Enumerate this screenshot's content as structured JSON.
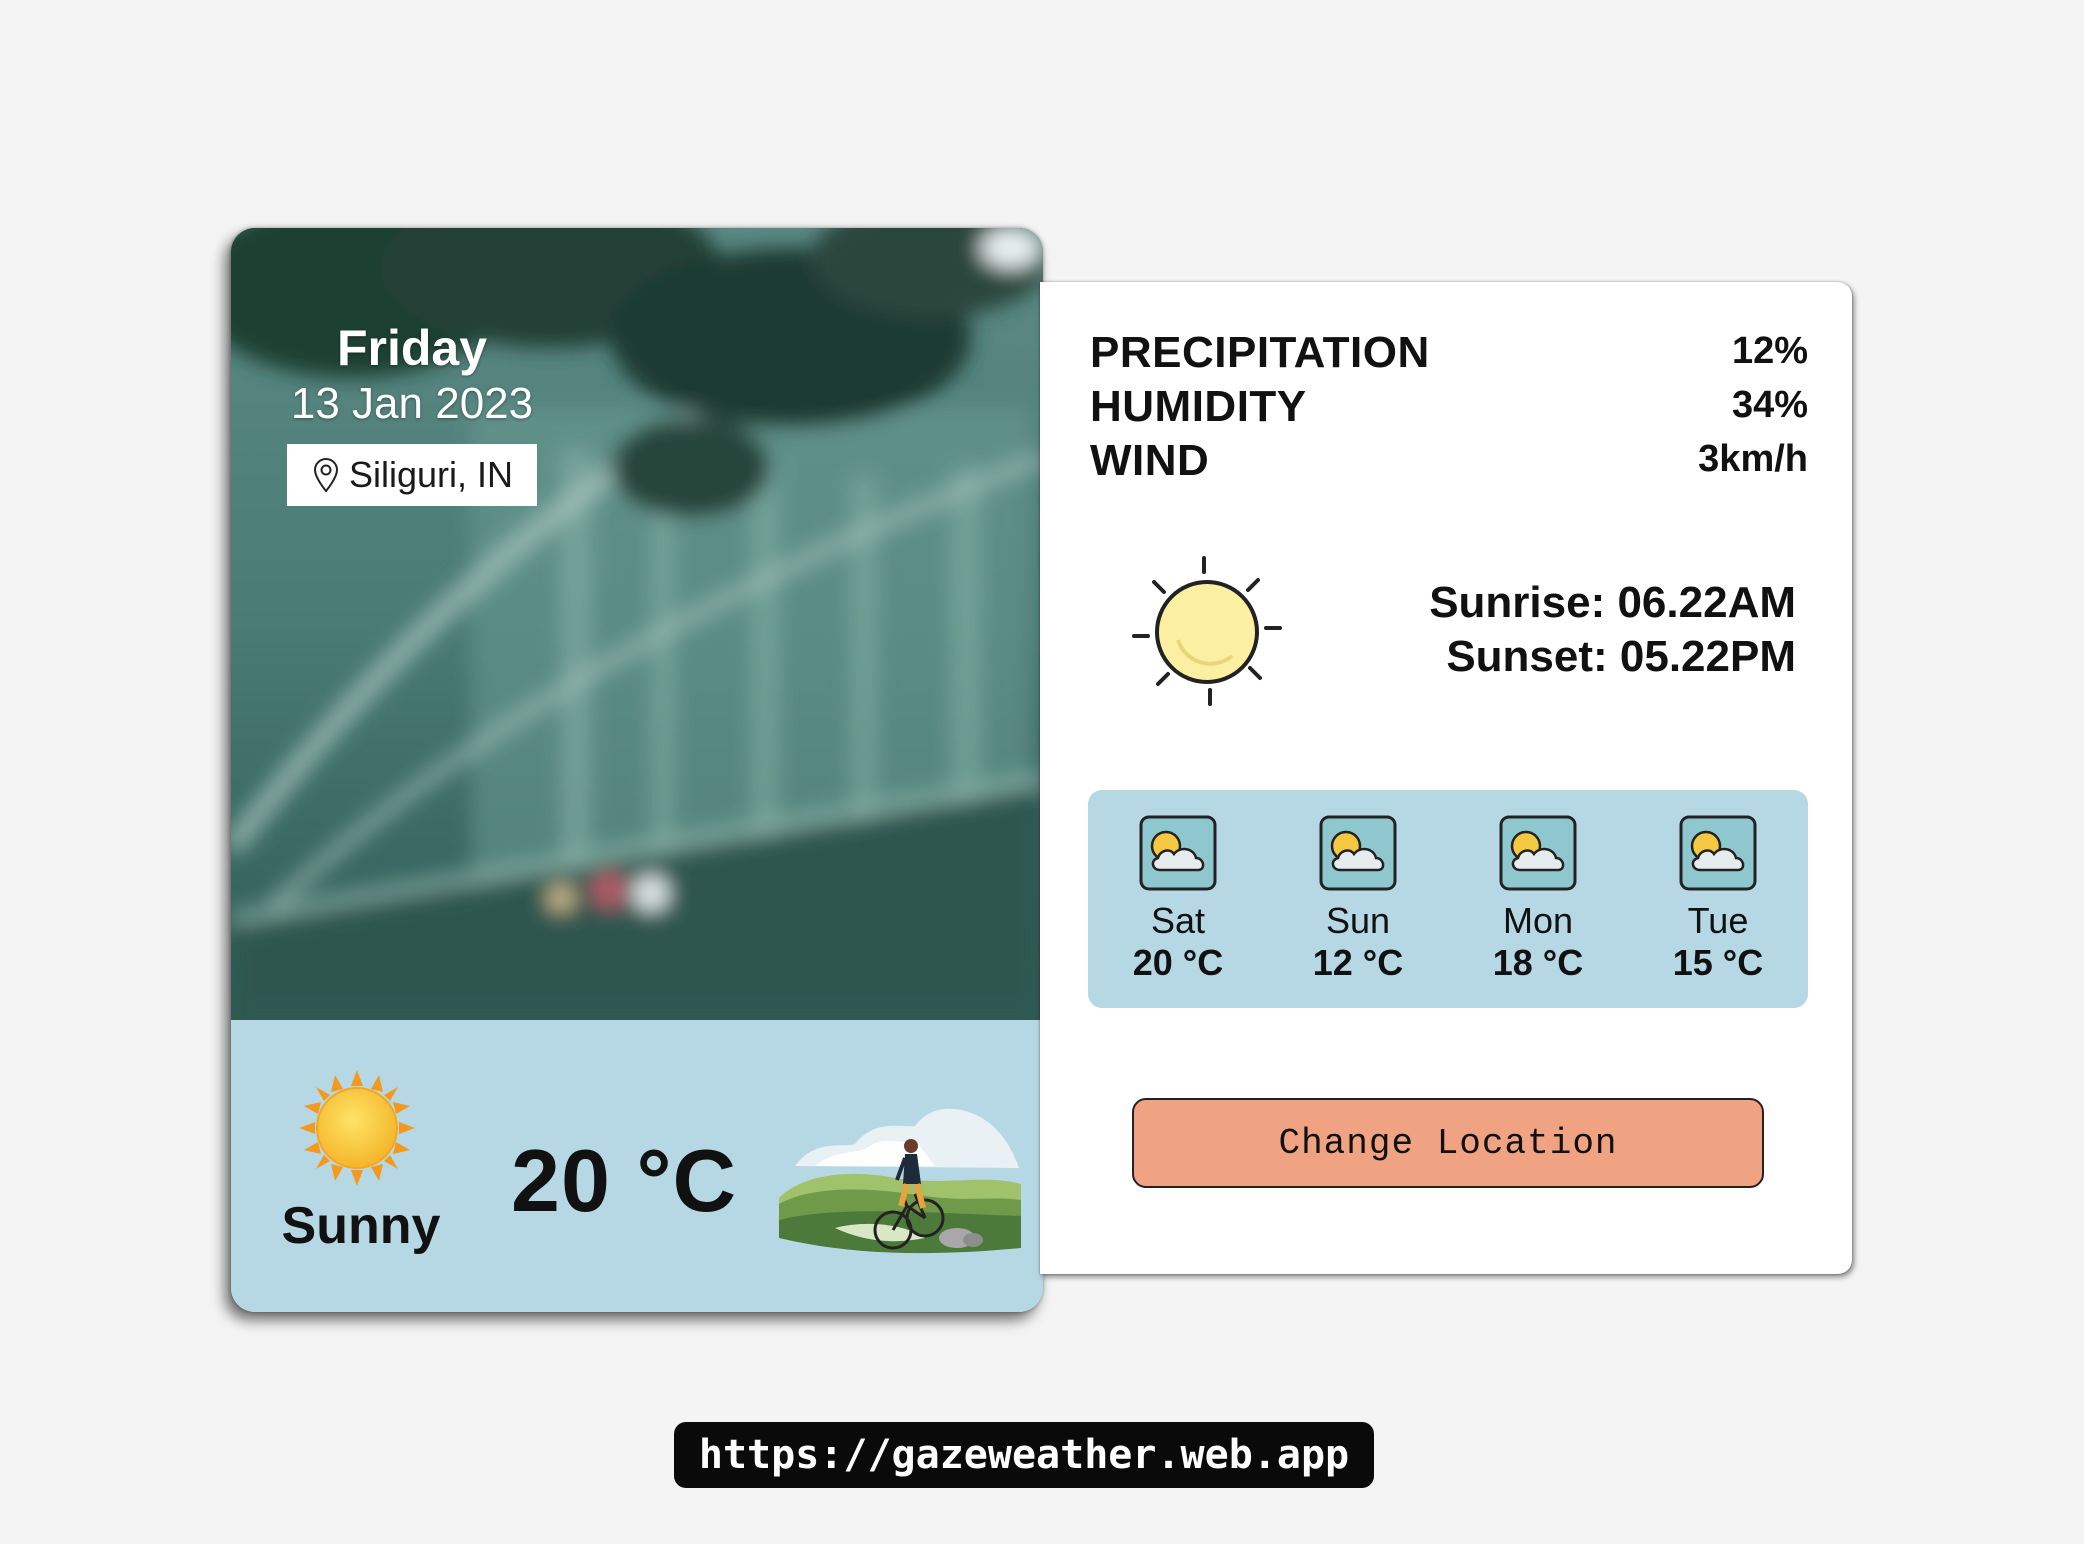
{
  "left_card": {
    "day": "Friday",
    "date": "13 Jan 2023",
    "location": "Siliguri, IN",
    "location_icon": "map-pin-icon",
    "condition": "Sunny",
    "condition_icon": "sun-icon",
    "temperature": "20 °C",
    "illustration": "cyclist-illustration"
  },
  "details": {
    "stats": [
      {
        "label": "PRECIPITATION",
        "value": "12%"
      },
      {
        "label": "HUMIDITY",
        "value": "34%"
      },
      {
        "label": "WIND",
        "value": "3km/h"
      }
    ],
    "sun_icon": "sun-outline-icon",
    "sunrise": "Sunrise: 06.22AM",
    "sunset": "Sunset: 05.22PM"
  },
  "forecast": [
    {
      "day": "Sat",
      "temp": "20 °C",
      "icon": "partly-cloudy-icon"
    },
    {
      "day": "Sun",
      "temp": "12 °C",
      "icon": "partly-cloudy-icon"
    },
    {
      "day": "Mon",
      "temp": "18 °C",
      "icon": "partly-cloudy-icon"
    },
    {
      "day": "Tue",
      "temp": "15 °C",
      "icon": "partly-cloudy-icon"
    }
  ],
  "actions": {
    "change_location_label": "Change Location"
  },
  "footer": {
    "url": "https://gazeweather.web.app"
  },
  "colors": {
    "page_bg": "#f4f4f4",
    "panel_blue": "#b6d8e4",
    "button_salmon": "#f0a383",
    "url_pill_bg": "#0a0a0a"
  }
}
